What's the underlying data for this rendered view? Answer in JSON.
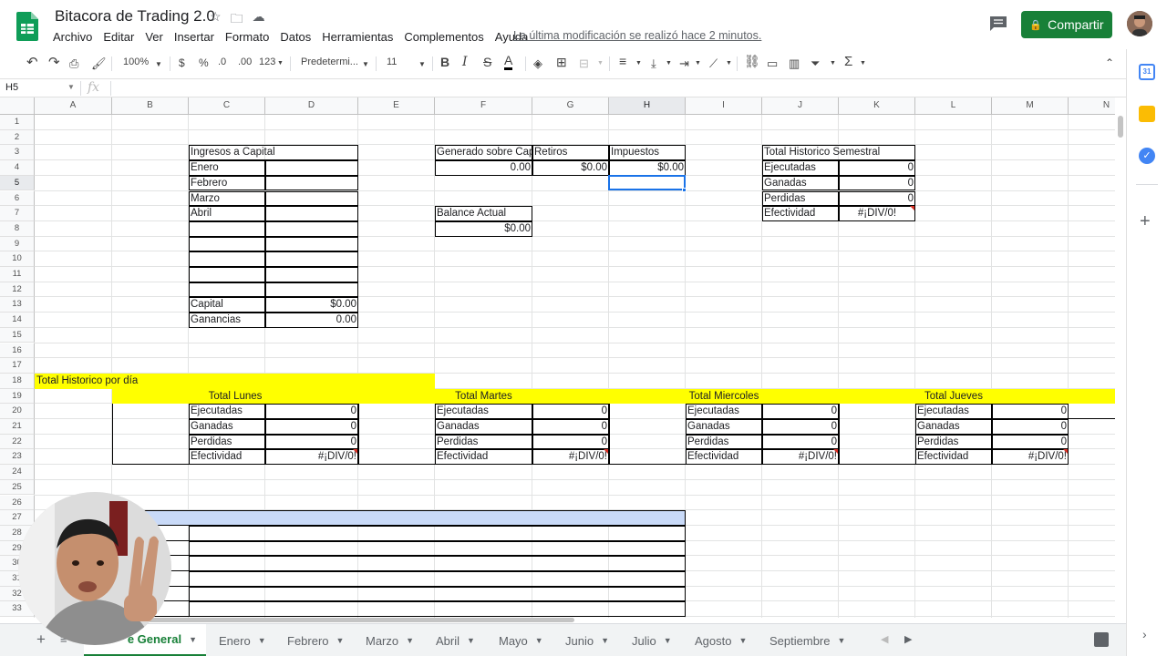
{
  "app": {
    "title": "Bitacora de Trading 2.0",
    "last_edit": "La última modificación se realizó hace 2 minutos.",
    "share_label": "Compartir"
  },
  "menu": [
    "Archivo",
    "Editar",
    "Ver",
    "Insertar",
    "Formato",
    "Datos",
    "Herramientas",
    "Complementos",
    "Ayuda"
  ],
  "toolbar": {
    "zoom": "100%",
    "currency": "$",
    "percent": "%",
    "dec_less": ".0",
    "dec_more": ".00",
    "format_more": "123",
    "font": "Predetermi...",
    "font_size": "11"
  },
  "formula_bar": {
    "cell_ref": "H5",
    "fx": "fx",
    "value": ""
  },
  "columns": [
    "A",
    "B",
    "C",
    "D",
    "E",
    "F",
    "G",
    "H",
    "I",
    "J",
    "K",
    "L",
    "M",
    "N"
  ],
  "rows": [
    "1",
    "2",
    "3",
    "4",
    "5",
    "6",
    "7",
    "8",
    "9",
    "10",
    "11",
    "12",
    "13",
    "14",
    "15",
    "16",
    "17",
    "18",
    "19",
    "20",
    "21",
    "22",
    "23",
    "24",
    "25",
    "26",
    "27",
    "28",
    "29",
    "30",
    "31",
    "32",
    "33"
  ],
  "cells": {
    "C3": "Ingresos a Capital",
    "C4": "Enero",
    "C5": "Febrero",
    "C6": "Marzo",
    "C7": "Abril",
    "C13": "Capital",
    "D13": "$0.00",
    "C14": "Ganancias",
    "D14": "0.00",
    "F3": "Generado sobre Cap",
    "G3": "Retiros",
    "H3": "Impuestos",
    "F4": "0.00",
    "G4": "$0.00",
    "H4": "$0.00",
    "F7": "Balance Actual",
    "F8": "$0.00",
    "J3": "Total Historico Semestral",
    "J4": "Ejecutadas",
    "K4": "0",
    "J5": "Ganadas",
    "K5": "0",
    "J6": "Perdidas",
    "K6": "0",
    "J7": "Efectividad",
    "K7": "#¡DIV/0!",
    "A18": "Total Historico por día",
    "lunes": "Total Lunes",
    "martes": "Total Martes",
    "miercoles": "Total Miercoles",
    "jueves": "Total Jueves",
    "ejec": "Ejecutadas",
    "gan": "Ganadas",
    "perd": "Perdidas",
    "efec": "Efectividad",
    "zero": "0",
    "div": "#¡DIV/0!"
  },
  "tabs": [
    {
      "label": "e General"
    },
    {
      "label": "Enero"
    },
    {
      "label": "Febrero"
    },
    {
      "label": "Marzo"
    },
    {
      "label": "Abril"
    },
    {
      "label": "Mayo"
    },
    {
      "label": "Junio"
    },
    {
      "label": "Julio"
    },
    {
      "label": "Agosto"
    },
    {
      "label": "Septiembre"
    }
  ],
  "colors": {
    "share": "#188038",
    "highlight": "#ffff00",
    "header_blue": "#c9daf8",
    "selection": "#1a73e8"
  }
}
